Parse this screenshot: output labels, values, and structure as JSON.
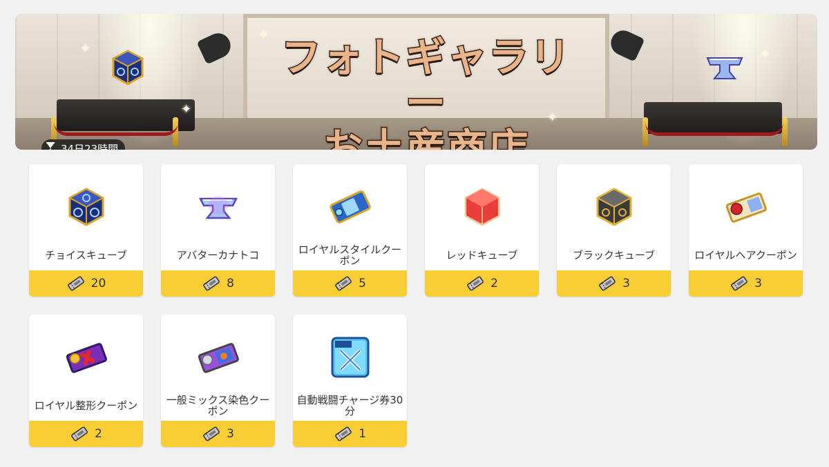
{
  "banner": {
    "title_line1": "フォトギャラリー",
    "title_line2": "お土産商店",
    "timer": "34日23時間"
  },
  "colors": {
    "price_bar": "#f9ce35",
    "card_bg": "#ffffff",
    "page_bg": "#f1f1f1",
    "title_fill": "#e9b48a",
    "title_stroke": "#3b2418"
  },
  "items": [
    {
      "name": "チョイスキューブ",
      "price": "20",
      "icon": "choice-cube-icon"
    },
    {
      "name": "アバターカナトコ",
      "price": "8",
      "icon": "anvil-icon"
    },
    {
      "name": "ロイヤルスタイルクーポン",
      "price": "5",
      "icon": "royal-style-coupon-icon"
    },
    {
      "name": "レッドキューブ",
      "price": "2",
      "icon": "red-cube-icon"
    },
    {
      "name": "ブラックキューブ",
      "price": "3",
      "icon": "black-cube-icon"
    },
    {
      "name": "ロイヤルヘアクーポン",
      "price": "3",
      "icon": "royal-hair-coupon-icon"
    },
    {
      "name": "ロイヤル整形クーポン",
      "price": "2",
      "icon": "royal-face-coupon-icon"
    },
    {
      "name": "一般ミックス染色クーポン",
      "price": "3",
      "icon": "mix-dye-coupon-icon"
    },
    {
      "name": "自動戦闘チャージ券30分",
      "price": "1",
      "icon": "auto-battle-ticket-icon"
    }
  ]
}
